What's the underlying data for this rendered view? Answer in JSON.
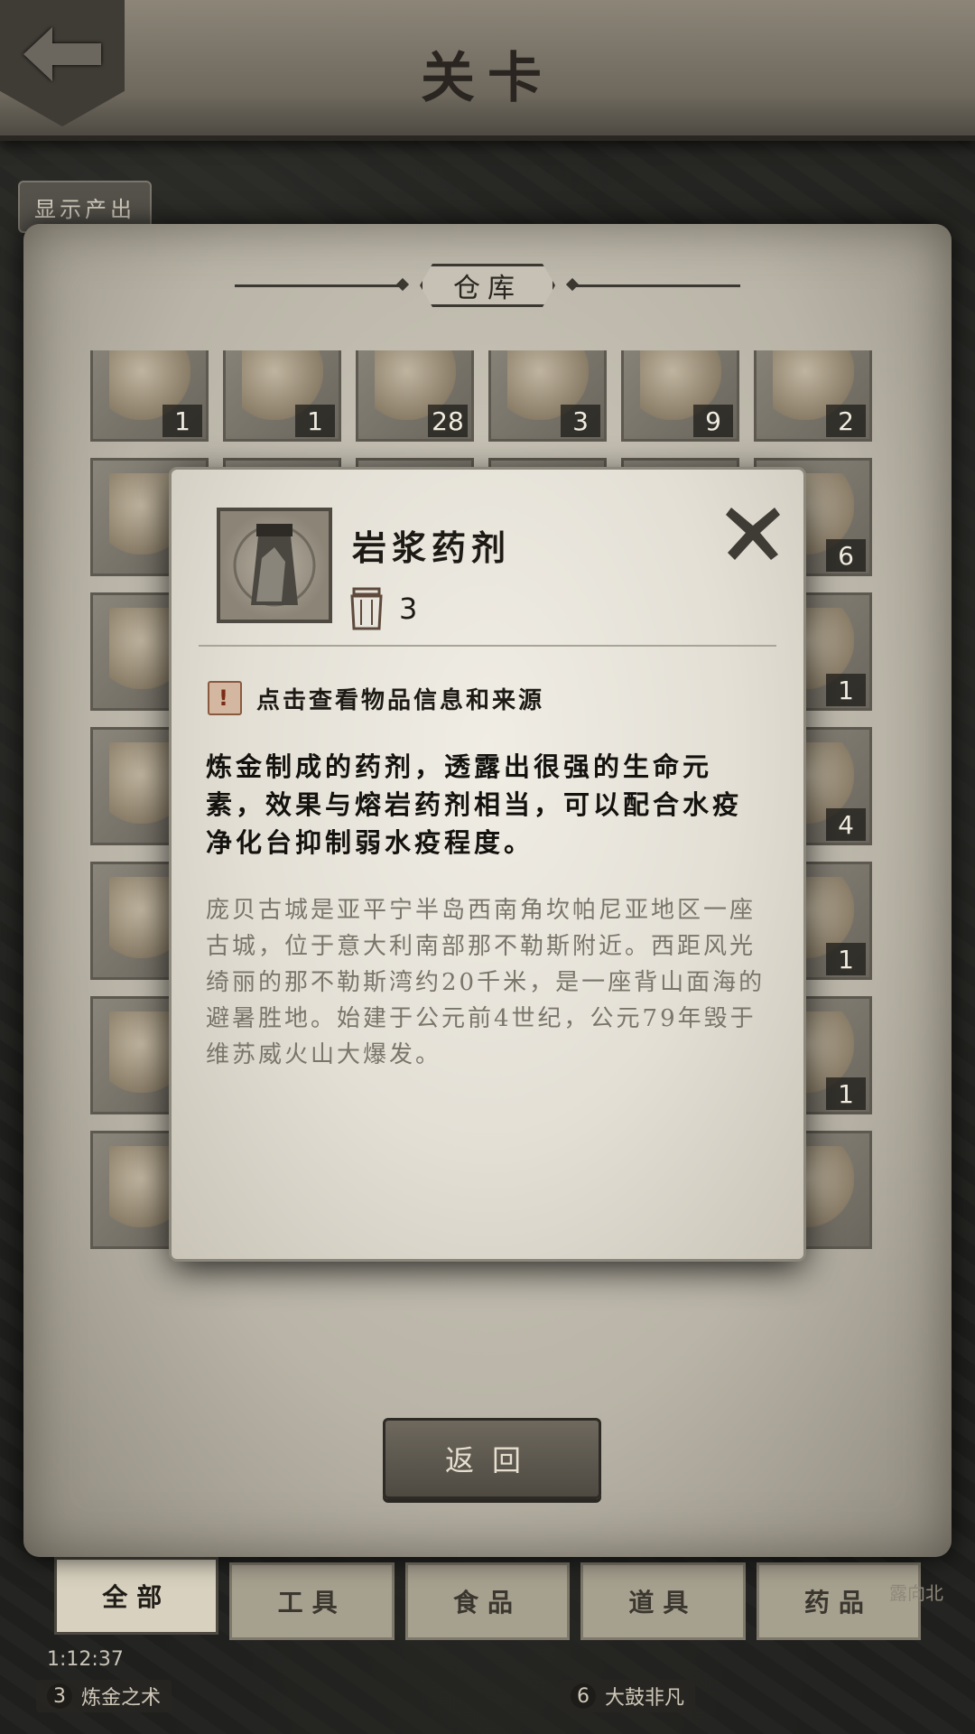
{
  "header": {
    "title": "关卡"
  },
  "toolbar": {
    "show_output_label": "显示产出"
  },
  "warehouse": {
    "title": "仓库",
    "return_label": "返回",
    "slots": [
      {
        "count": "1"
      },
      {
        "count": "1"
      },
      {
        "count": "28"
      },
      {
        "count": "3"
      },
      {
        "count": "9"
      },
      {
        "count": "2"
      },
      {
        "count": ""
      },
      {
        "count": ""
      },
      {
        "count": ""
      },
      {
        "count": ""
      },
      {
        "count": ""
      },
      {
        "count": "6"
      },
      {
        "count": ""
      },
      {
        "count": ""
      },
      {
        "count": ""
      },
      {
        "count": ""
      },
      {
        "count": ""
      },
      {
        "count": "1"
      },
      {
        "count": ""
      },
      {
        "count": ""
      },
      {
        "count": ""
      },
      {
        "count": ""
      },
      {
        "count": ""
      },
      {
        "count": "4"
      },
      {
        "count": ""
      },
      {
        "count": ""
      },
      {
        "count": ""
      },
      {
        "count": ""
      },
      {
        "count": ""
      },
      {
        "count": "1"
      },
      {
        "count": ""
      },
      {
        "count": ""
      },
      {
        "count": ""
      },
      {
        "count": ""
      },
      {
        "count": ""
      },
      {
        "count": "1"
      },
      {
        "count": ""
      },
      {
        "count": ""
      },
      {
        "count": ""
      },
      {
        "count": ""
      },
      {
        "count": ""
      },
      {
        "count": ""
      }
    ]
  },
  "tabs": [
    "全部",
    "工具",
    "食品",
    "道具",
    "药品"
  ],
  "active_tab_index": 0,
  "hud": {
    "timer": "1:12:37",
    "left_chip": {
      "num": "3",
      "label": "炼金之术"
    },
    "mid_chip": {
      "num": "6",
      "label": "大鼓非凡"
    },
    "right_label": "露向北"
  },
  "popup": {
    "item_name": "岩浆药剂",
    "capacity": "3",
    "info_hint": "点击查看物品信息和来源",
    "description": "炼金制成的药剂，透露出很强的生命元素，效果与熔岩药剂相当，可以配合水疫净化台抑制弱水疫程度。",
    "lore": "庞贝古城是亚平宁半岛西南角坎帕尼亚地区一座古城，位于意大利南部那不勒斯附近。西距风光绮丽的那不勒斯湾约20千米，是一座背山面海的避暑胜地。始建于公元前4世纪，公元79年毁于维苏威火山大爆发。"
  },
  "colors": {
    "parchment": "#e3dfd5",
    "ink": "#1d1a15",
    "lore_text": "#7a756a",
    "slot_bg": "#6a665d"
  }
}
